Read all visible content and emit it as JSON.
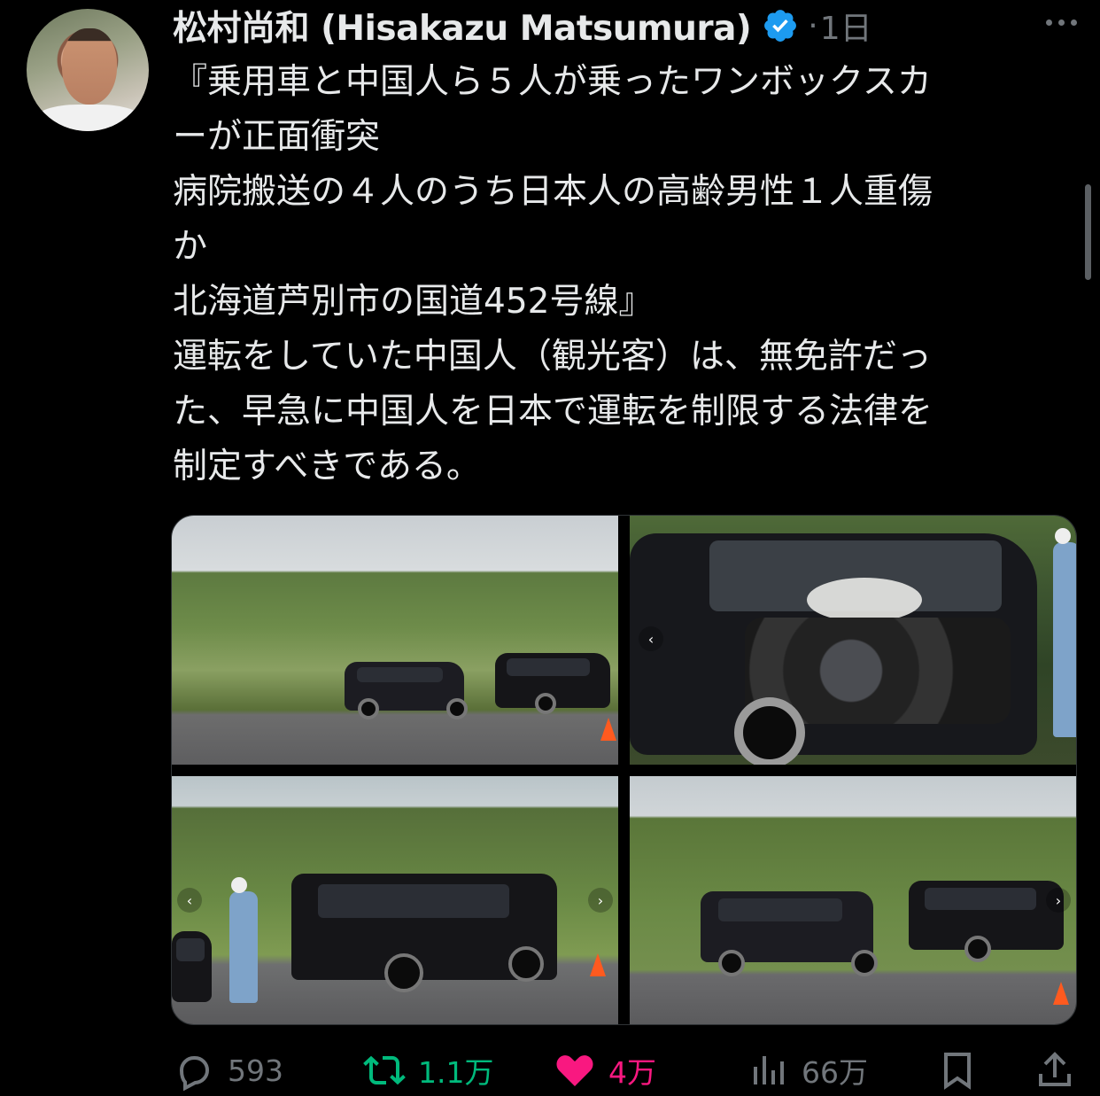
{
  "author": {
    "name": "松村尚和 (Hisakazu Matsumura)",
    "separator": "·",
    "time": "1日"
  },
  "tweet": {
    "text": "『乗用車と中国人ら５人が乗ったワンボックスカ\nーが正面衝突\n病院搬送の４人のうち日本人の高齢男性１人重傷\nか\n北海道芦別市の国道452号線』\n運転をしていた中国人（観光客）は、無免許だっ\nた、早急に中国人を日本で運転を制限する法律を\n制定すべきである。"
  },
  "metrics": {
    "replies": "593",
    "retweets": "1.1万",
    "likes": "4万",
    "views": "66万"
  },
  "colors": {
    "background": "#000000",
    "text": "#e7e9ea",
    "muted": "#71767b",
    "verified": "#1d9bf0",
    "retweet": "#00ba7c",
    "like": "#f91880"
  },
  "icons": [
    "verified-badge-icon",
    "more-icon",
    "reply-icon",
    "retweet-icon",
    "like-icon",
    "views-icon",
    "bookmark-icon",
    "share-icon"
  ]
}
